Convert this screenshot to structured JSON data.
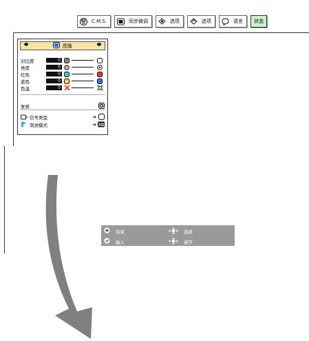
{
  "topbar": {
    "tabs": [
      {
        "label": "C.M.S.",
        "icon": "cms-icon"
      },
      {
        "label": "同步微调",
        "icon": "sync-icon"
      },
      {
        "label": "选项",
        "icon": "option1-icon"
      },
      {
        "label": "选项",
        "icon": "option2-icon"
      },
      {
        "label": "语言",
        "icon": "language-icon"
      },
      {
        "label": "状态",
        "icon": ""
      }
    ]
  },
  "panel": {
    "title": "图像",
    "rows": [
      {
        "label": "对比度",
        "value": "0"
      },
      {
        "label": "亮度",
        "value": "0"
      },
      {
        "label": "红色",
        "value": "0"
      },
      {
        "label": "蓝色",
        "value": "0"
      },
      {
        "label": "色温",
        "value": "0"
      }
    ],
    "reset_label": "复原",
    "signal_label": "信号类型",
    "progressive_label": "渐进模式"
  },
  "help": {
    "end_label": "结束",
    "select_label": "选择",
    "enter_label": "输入",
    "adjust_label": "调节"
  },
  "colors": {
    "active_tab": "#c9f1c9",
    "panel_header": "#f6e6a6",
    "help_bar": "#9a9a9a",
    "arrow": "#808080"
  }
}
